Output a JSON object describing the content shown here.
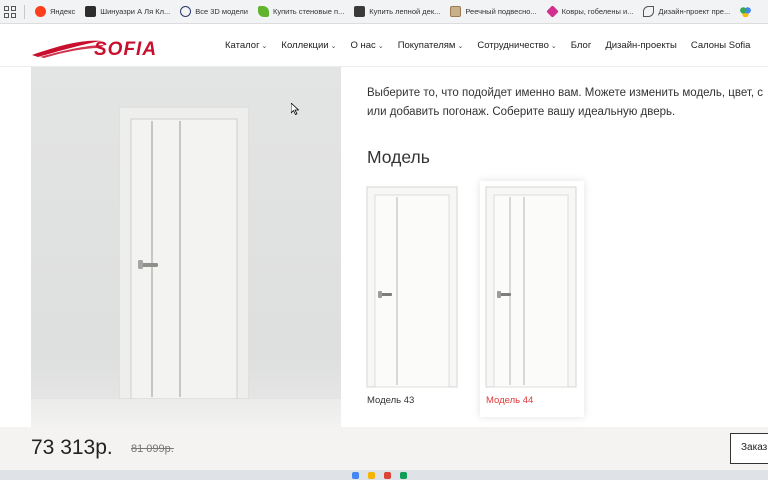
{
  "bookmarks": [
    {
      "label": "Яндекс",
      "icon": "yandex-icon",
      "color": "#fc3f1d"
    },
    {
      "label": "Шинуазри А Ля Кл...",
      "icon": "photo-icon",
      "color": "#2d2d2d"
    },
    {
      "label": "Все 3D модели",
      "icon": "3d-icon",
      "color": "#2b3a6b"
    },
    {
      "label": "Купить стеновые п...",
      "icon": "leaf-icon",
      "color": "#62b32e"
    },
    {
      "label": "Купить лепной дек...",
      "icon": "photo-icon",
      "color": "#3a3a3a"
    },
    {
      "label": "Реечный подвесно...",
      "icon": "page-icon",
      "color": "#9c7b53"
    },
    {
      "label": "Ковры, гобелены и...",
      "icon": "carpet-icon",
      "color": "#d32f8c"
    },
    {
      "label": "Дизайн-проект пре...",
      "icon": "design-icon",
      "color": "#555555"
    }
  ],
  "header": {
    "logo_text": "SOFIA",
    "nav": [
      {
        "label": "Каталог",
        "dropdown": true
      },
      {
        "label": "Коллекции",
        "dropdown": true
      },
      {
        "label": "О нас",
        "dropdown": true
      },
      {
        "label": "Покупателям",
        "dropdown": true
      },
      {
        "label": "Сотрудничество",
        "dropdown": true
      },
      {
        "label": "Блог",
        "dropdown": false
      },
      {
        "label": "Дизайн-проекты",
        "dropdown": false
      },
      {
        "label": "Салоны Sofia",
        "dropdown": false
      }
    ]
  },
  "content": {
    "intro_line1": "Выберите то, что подойдет именно вам. Можете изменить модель, цвет, с",
    "intro_line2": "или добавить погонаж. Соберите вашу идеальную дверь.",
    "model_heading": "Модель",
    "models": [
      {
        "label": "Модель 43",
        "selected": false
      },
      {
        "label": "Модель 44",
        "selected": true
      }
    ]
  },
  "price": {
    "current": "73 313р.",
    "old": "81 099р.",
    "order_label": "Заказ"
  },
  "colors": {
    "brand_red": "#c8102e",
    "selected_red": "#e03a3a"
  }
}
